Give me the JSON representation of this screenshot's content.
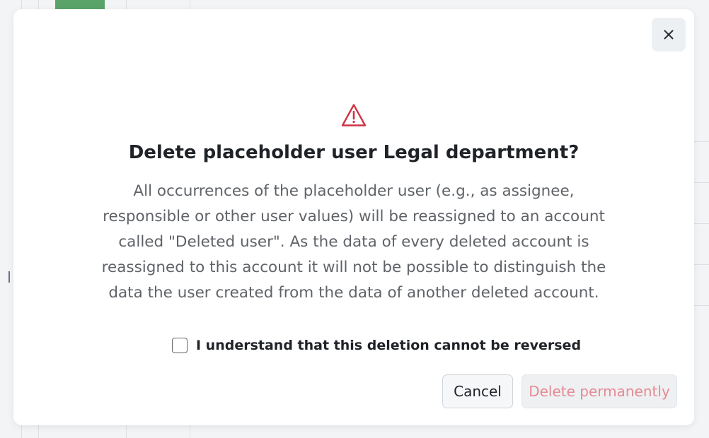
{
  "dialog": {
    "title": "Delete placeholder user Legal department?",
    "description": "All occurrences of the placeholder user (e.g., as assignee, responsible or other user values) will be reassigned to an account called \"Deleted user\". As the data of every deleted account is reassigned to this account it will not be possible to distinguish the data the user created from the data of another deleted account.",
    "confirm_label": "I understand that this deletion cannot be reversed",
    "confirm_checked": false,
    "cancel_label": "Cancel",
    "delete_label": "Delete permanently",
    "delete_enabled": false,
    "close_aria": "Close"
  },
  "icons": {
    "close": "close-icon",
    "warning": "warning-triangle-icon"
  },
  "colors": {
    "warning": "#cf3343",
    "delete_disabled_text": "#e58a93",
    "background_accent": "#5aa469"
  }
}
